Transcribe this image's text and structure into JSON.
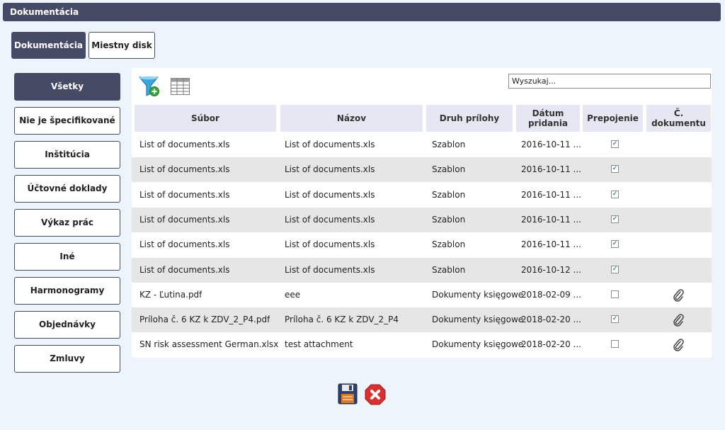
{
  "window": {
    "title": "Dokumentácia"
  },
  "tabs": [
    {
      "label": "Dokumentácia",
      "active": true
    },
    {
      "label": "Miestny disk",
      "active": false
    }
  ],
  "categories": [
    {
      "label": "Všetky",
      "active": true
    },
    {
      "label": "Nie je špecifikované"
    },
    {
      "label": "Inštitúcia"
    },
    {
      "label": "Účtovné doklady"
    },
    {
      "label": "Výkaz prác"
    },
    {
      "label": "Iné"
    },
    {
      "label": "Harmonogramy"
    },
    {
      "label": "Objednávky"
    },
    {
      "label": "Zmluvy"
    }
  ],
  "toolbar": {
    "icons": [
      "add-filter-icon",
      "table-view-icon"
    ]
  },
  "search": {
    "placeholder": "Wyszukaj..."
  },
  "table": {
    "columns": [
      "Súbor",
      "Názov",
      "Druh prílohy",
      "Dátum pridania",
      "Prepojenie",
      "Č. dokumentu"
    ],
    "rows": [
      {
        "file": "List of documents.xls",
        "name": "List of documents.xls",
        "type": "Szablon",
        "date": "2016-10-11 ...",
        "linked": true,
        "attachment": false
      },
      {
        "file": "List of documents.xls",
        "name": "List of documents.xls",
        "type": "Szablon",
        "date": "2016-10-11 ...",
        "linked": true,
        "attachment": false
      },
      {
        "file": "List of documents.xls",
        "name": "List of documents.xls",
        "type": "Szablon",
        "date": "2016-10-11 ...",
        "linked": true,
        "attachment": false
      },
      {
        "file": "List of documents.xls",
        "name": "List of documents.xls",
        "type": "Szablon",
        "date": "2016-10-11 ...",
        "linked": true,
        "attachment": false
      },
      {
        "file": "List of documents.xls",
        "name": "List of documents.xls",
        "type": "Szablon",
        "date": "2016-10-11 ...",
        "linked": true,
        "attachment": false
      },
      {
        "file": "List of documents.xls",
        "name": "List of documents.xls",
        "type": "Szablon",
        "date": "2016-10-12 ...",
        "linked": true,
        "attachment": false
      },
      {
        "file": "KZ - Ľutina.pdf",
        "name": "eee",
        "type": "Dokumenty księgowe",
        "date": "2018-02-09 ...",
        "linked": false,
        "attachment": true
      },
      {
        "file": "Príloha č. 6 KZ k ZDV_2_P4.pdf",
        "name": "Príloha č. 6 KZ k ZDV_2_P4",
        "type": "Dokumenty księgowe",
        "date": "2018-02-20 ...",
        "linked": true,
        "attachment": true
      },
      {
        "file": "SN risk assessment German.xlsx",
        "name": "test attachment",
        "type": "Dokumenty księgowe",
        "date": "2018-02-20 ...",
        "linked": false,
        "attachment": true
      }
    ]
  },
  "actions": {
    "icons": [
      "save-icon",
      "cancel-icon"
    ]
  },
  "colors": {
    "header_bg": "#454b65",
    "column_header_bg": "#e7e7f4",
    "row_alt_bg": "#e6e6e6"
  }
}
